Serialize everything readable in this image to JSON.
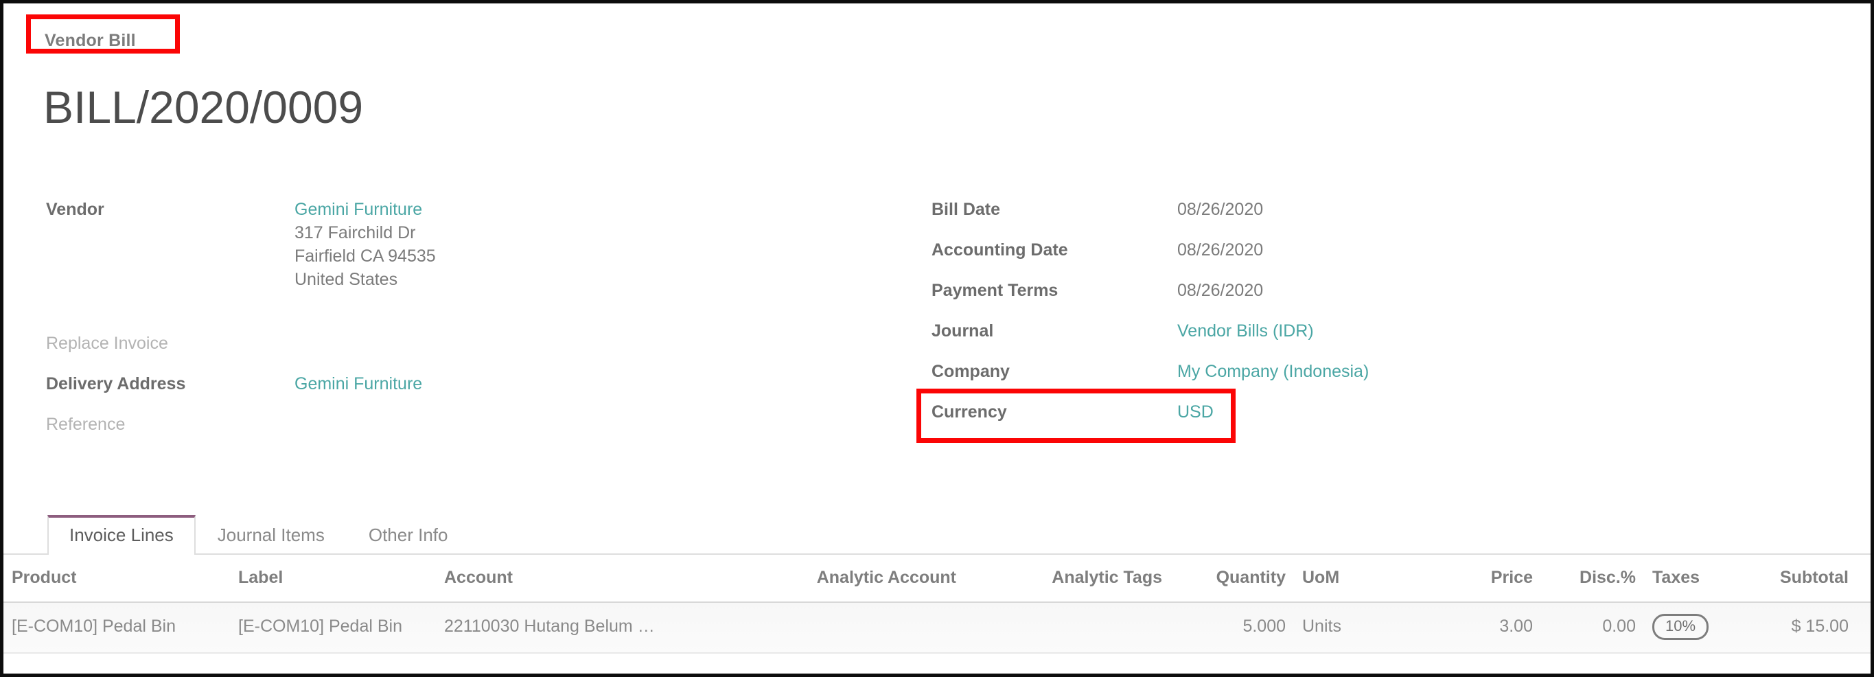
{
  "breadcrumb": {
    "label": "Vendor Bill"
  },
  "title": "BILL/2020/0009",
  "colors": {
    "link_teal": "#4aa6a4",
    "annotation_red": "#fb0505",
    "tab_active_accent": "#8d5d7e",
    "label_gray": "#6c6c6c",
    "value_gray": "#7b7b7b",
    "placeholder_gray": "#b3b3b3"
  },
  "left_fields": {
    "vendor": {
      "label": "Vendor",
      "value": "Gemini Furniture",
      "address": [
        "317 Fairchild Dr",
        "Fairfield CA 94535",
        "United States"
      ]
    },
    "replace_invoice": {
      "label": "Replace Invoice",
      "value": ""
    },
    "delivery_address": {
      "label": "Delivery Address",
      "value": "Gemini Furniture"
    },
    "reference": {
      "label": "Reference",
      "value": ""
    }
  },
  "right_fields": [
    {
      "label": "Bill Date",
      "value": "08/26/2020",
      "link": false
    },
    {
      "label": "Accounting Date",
      "value": "08/26/2020",
      "link": false
    },
    {
      "label": "Payment Terms",
      "value": "08/26/2020",
      "link": false
    },
    {
      "label": "Journal",
      "value": "Vendor Bills (IDR)",
      "link": true
    },
    {
      "label": "Company",
      "value": "My Company (Indonesia)",
      "link": true
    },
    {
      "label": "Currency",
      "value": "USD",
      "link": true
    }
  ],
  "tabs": [
    {
      "label": "Invoice Lines",
      "active": true
    },
    {
      "label": "Journal Items",
      "active": false
    },
    {
      "label": "Other Info",
      "active": false
    }
  ],
  "table": {
    "columns": [
      "Product",
      "Label",
      "Account",
      "Analytic Account",
      "Analytic Tags",
      "Quantity",
      "UoM",
      "Price",
      "Disc.%",
      "Taxes",
      "Subtotal"
    ],
    "optional_columns_icon": "vertical-dots-icon",
    "rows": [
      {
        "product": "[E-COM10] Pedal Bin",
        "label": "[E-COM10] Pedal Bin",
        "account": "22110030 Hutang Belum …",
        "analytic_account": "",
        "analytic_tags": "",
        "quantity": "5.000",
        "uom": "Units",
        "price": "3.00",
        "discount": "0.00",
        "taxes": "10%",
        "subtotal": "$ 15.00"
      }
    ]
  },
  "annotations": [
    {
      "name": "vendor-bill-highlight",
      "target": "breadcrumb"
    },
    {
      "name": "currency-highlight",
      "target": "currency-field"
    }
  ]
}
